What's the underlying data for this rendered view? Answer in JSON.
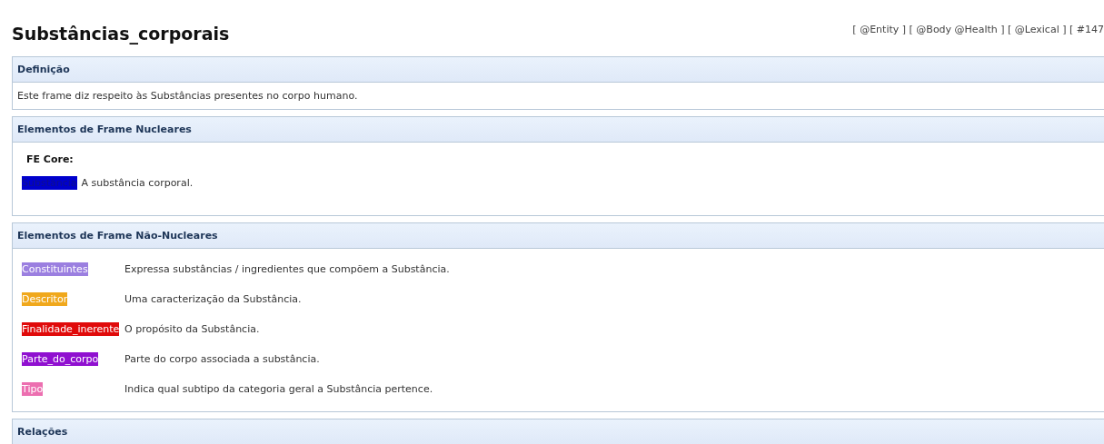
{
  "title": "Substâncias_corporais",
  "tags": "[ @Entity ] [ @Body @Health ] [ @Lexical ] [ #147",
  "sections": [
    {
      "kind": "text",
      "heading": "Definição",
      "text": "Este frame diz respeito às Substâncias presentes no corpo humano."
    },
    {
      "kind": "core",
      "heading": "Elementos de Frame Nucleares",
      "subheading": "FE Core:",
      "elements": [
        {
          "name": "Substância",
          "color": "#0000cd",
          "description": "A substância corporal."
        }
      ]
    },
    {
      "kind": "table",
      "heading": "Elementos de Frame Não-Nucleares",
      "elements": [
        {
          "name": "Constituintes",
          "color": "#9b7fe0",
          "description": "Expressa substâncias / ingredientes que compõem a Substância."
        },
        {
          "name": "Descritor",
          "color": "#f0a81c",
          "description": "Uma caracterização da Substância."
        },
        {
          "name": "Finalidade_inerente",
          "color": "#e00a0a",
          "description": "O propósito da Substância."
        },
        {
          "name": "Parte_do_corpo",
          "color": "#9010d0",
          "description": "Parte do corpo associada a substância."
        },
        {
          "name": "Tipo",
          "color": "#ec6fb0",
          "description": "Indica qual subtipo da categoria geral a Substância pertence."
        }
      ]
    },
    {
      "kind": "collapsed",
      "heading": "Relações"
    }
  ]
}
